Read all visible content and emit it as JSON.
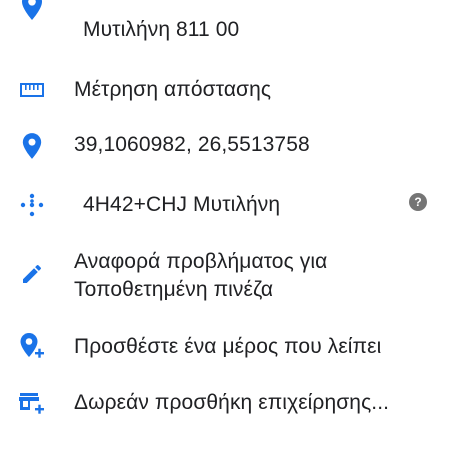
{
  "address": {
    "line2": "Μυτιλήνη 811 00",
    "icon": "location-pin-icon"
  },
  "measure": {
    "label": "Μέτρηση απόστασης",
    "icon": "ruler-icon"
  },
  "coordinates": {
    "value": "39,1060982, 26,5513758",
    "icon": "location-pin-icon"
  },
  "plus_code": {
    "value": "4H42+CHJ Μυτιλήνη",
    "icon": "plus-code-dots-icon",
    "help_glyph": "?"
  },
  "report": {
    "line1": "Αναφορά προβλήματος για",
    "line2": "Τοποθετημένη πινέζα",
    "icon": "edit-pencil-icon"
  },
  "add_place": {
    "label": "Προσθέστε ένα μέρος που λείπει",
    "icon": "add-location-icon"
  },
  "add_business": {
    "label": "Δωρεάν προσθήκη επιχείρησης...",
    "icon": "add-business-icon"
  },
  "colors": {
    "accent": "#1a73e8",
    "text": "#202124",
    "help_badge": "#757575"
  }
}
